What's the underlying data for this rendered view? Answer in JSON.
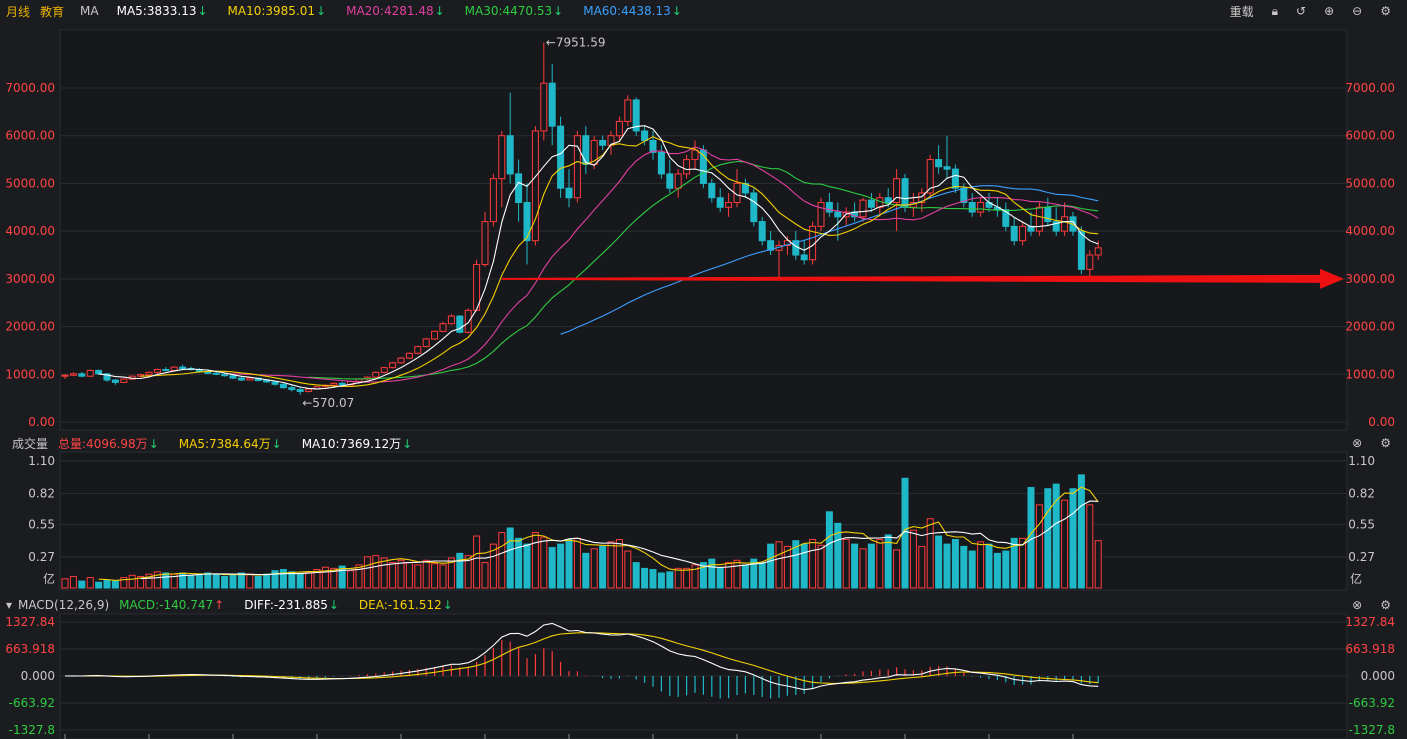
{
  "header": {
    "period": "月线",
    "name": "教育",
    "indicator": "MA",
    "ma5": "MA5:3833.13",
    "ma10": "MA10:3985.01",
    "ma20": "MA20:4281.48",
    "ma30": "MA30:4470.53",
    "ma60": "MA60:4438.13",
    "down_arrow": "↓",
    "reload": "重载"
  },
  "volume_header": {
    "title": "成交量",
    "total": "总量:4096.98万",
    "ma5": "MA5:7384.64万",
    "ma10": "MA10:7369.12万",
    "arrow": "↓"
  },
  "macd_header": {
    "title": "MACD(12,26,9)",
    "macd": "MACD:-140.747",
    "macd_arrow": "↑",
    "diff": "DIFF:-231.885",
    "dea": "DEA:-161.512",
    "arrow": "↓"
  },
  "colors": {
    "up": "#ff3b3b",
    "down": "#1fb8c8",
    "ma5": "#ffffff",
    "ma10": "#f5d000",
    "ma20": "#e040a0",
    "ma30": "#2ecc40",
    "ma60": "#3aa0ff",
    "grid": "#2a2c33",
    "axis_text": "#ff4444",
    "annotation_arrow": "#ee1111"
  },
  "chart_data": [
    {
      "type": "candlestick",
      "ylim": [
        0,
        8000
      ],
      "y_ticks": [
        "7000.00",
        "6000.00",
        "5000.00",
        "4000.00",
        "3000.00",
        "2000.00",
        "1000.00",
        "0.00"
      ],
      "annotations": {
        "high": "←7951.59",
        "low": "←570.07"
      },
      "highlight_level": 3000,
      "ohlc": [
        [
          960,
          1000,
          900,
          980
        ],
        [
          980,
          1040,
          960,
          1010
        ],
        [
          1010,
          1050,
          940,
          960
        ],
        [
          960,
          1100,
          950,
          1080
        ],
        [
          1080,
          1100,
          990,
          1010
        ],
        [
          1010,
          1020,
          840,
          880
        ],
        [
          880,
          900,
          780,
          830
        ],
        [
          830,
          920,
          820,
          900
        ],
        [
          900,
          980,
          880,
          960
        ],
        [
          960,
          1010,
          930,
          990
        ],
        [
          990,
          1060,
          970,
          1040
        ],
        [
          1040,
          1120,
          1020,
          1100
        ],
        [
          1100,
          1150,
          1060,
          1080
        ],
        [
          1080,
          1170,
          1060,
          1150
        ],
        [
          1150,
          1200,
          1100,
          1120
        ],
        [
          1120,
          1160,
          1080,
          1100
        ],
        [
          1100,
          1130,
          1030,
          1050
        ],
        [
          1050,
          1080,
          1000,
          1020
        ],
        [
          1020,
          1060,
          980,
          1000
        ],
        [
          1000,
          1030,
          950,
          970
        ],
        [
          970,
          1010,
          900,
          920
        ],
        [
          920,
          960,
          860,
          880
        ],
        [
          880,
          940,
          870,
          920
        ],
        [
          920,
          930,
          850,
          870
        ],
        [
          870,
          900,
          820,
          840
        ],
        [
          840,
          860,
          760,
          790
        ],
        [
          790,
          830,
          700,
          720
        ],
        [
          720,
          760,
          640,
          680
        ],
        [
          680,
          720,
          570,
          640
        ],
        [
          640,
          700,
          620,
          690
        ],
        [
          690,
          760,
          680,
          740
        ],
        [
          740,
          790,
          720,
          770
        ],
        [
          770,
          830,
          750,
          810
        ],
        [
          810,
          840,
          760,
          780
        ],
        [
          780,
          860,
          770,
          850
        ],
        [
          850,
          920,
          830,
          900
        ],
        [
          900,
          960,
          880,
          940
        ],
        [
          940,
          1060,
          920,
          1040
        ],
        [
          1040,
          1160,
          1020,
          1140
        ],
        [
          1140,
          1260,
          1120,
          1240
        ],
        [
          1240,
          1360,
          1220,
          1340
        ],
        [
          1340,
          1460,
          1320,
          1440
        ],
        [
          1440,
          1600,
          1420,
          1580
        ],
        [
          1580,
          1760,
          1560,
          1740
        ],
        [
          1740,
          1920,
          1720,
          1900
        ],
        [
          1900,
          2100,
          1880,
          2060
        ],
        [
          2060,
          2260,
          2040,
          2220
        ],
        [
          2220,
          2240,
          1860,
          1880
        ],
        [
          1880,
          2380,
          1860,
          2340
        ],
        [
          2340,
          3400,
          2320,
          3300
        ],
        [
          3300,
          4400,
          3250,
          4200
        ],
        [
          4200,
          5200,
          4100,
          5100
        ],
        [
          5100,
          6100,
          4500,
          6000
        ],
        [
          6000,
          6900,
          5000,
          5200
        ],
        [
          5200,
          5500,
          4200,
          4600
        ],
        [
          4600,
          5000,
          3300,
          3800
        ],
        [
          3800,
          6200,
          3700,
          6100
        ],
        [
          6100,
          7951,
          5900,
          7100
        ],
        [
          7100,
          7500,
          5800,
          6200
        ],
        [
          6200,
          6400,
          4700,
          4900
        ],
        [
          4900,
          5300,
          4500,
          4700
        ],
        [
          4700,
          6100,
          4600,
          6000
        ],
        [
          6000,
          6200,
          5200,
          5400
        ],
        [
          5400,
          6000,
          5300,
          5900
        ],
        [
          5900,
          6000,
          5700,
          5800
        ],
        [
          5800,
          6100,
          5600,
          6000
        ],
        [
          6000,
          6400,
          5900,
          6300
        ],
        [
          6300,
          6850,
          6200,
          6750
        ],
        [
          6750,
          6800,
          6000,
          6100
        ],
        [
          6100,
          6200,
          5800,
          5900
        ],
        [
          5900,
          6100,
          5500,
          5650
        ],
        [
          5650,
          5800,
          5100,
          5200
        ],
        [
          5200,
          5500,
          4800,
          4900
        ],
        [
          4900,
          5300,
          4700,
          5200
        ],
        [
          5200,
          5600,
          5100,
          5500
        ],
        [
          5500,
          5900,
          5300,
          5700
        ],
        [
          5700,
          5800,
          4900,
          5000
        ],
        [
          5000,
          5100,
          4600,
          4700
        ],
        [
          4700,
          4900,
          4400,
          4500
        ],
        [
          4500,
          4800,
          4300,
          4600
        ],
        [
          4600,
          5300,
          4500,
          5000
        ],
        [
          5000,
          5100,
          4700,
          4800
        ],
        [
          4800,
          4900,
          4100,
          4200
        ],
        [
          4200,
          4300,
          3700,
          3800
        ],
        [
          3800,
          4000,
          3500,
          3600
        ],
        [
          3600,
          3800,
          3000,
          3700
        ],
        [
          3700,
          3900,
          3500,
          3800
        ],
        [
          3800,
          4000,
          3400,
          3500
        ],
        [
          3500,
          3800,
          3300,
          3400
        ],
        [
          3400,
          4200,
          3300,
          4100
        ],
        [
          4100,
          4700,
          4000,
          4600
        ],
        [
          4600,
          4800,
          4300,
          4400
        ],
        [
          4400,
          4600,
          3800,
          4300
        ],
        [
          4300,
          4500,
          4100,
          4400
        ],
        [
          4400,
          4600,
          4200,
          4300
        ],
        [
          4300,
          4700,
          4200,
          4650
        ],
        [
          4650,
          4800,
          4400,
          4500
        ],
        [
          4500,
          4800,
          4300,
          4700
        ],
        [
          4700,
          4900,
          4500,
          4600
        ],
        [
          4600,
          5300,
          4000,
          5100
        ],
        [
          5100,
          5200,
          4400,
          4500
        ],
        [
          4500,
          4800,
          4300,
          4600
        ],
        [
          4600,
          4900,
          4400,
          4800
        ],
        [
          4800,
          5600,
          4700,
          5500
        ],
        [
          5500,
          5800,
          5200,
          5350
        ],
        [
          5350,
          6000,
          5100,
          5300
        ],
        [
          5300,
          5400,
          4800,
          4900
        ],
        [
          4900,
          5000,
          4500,
          4600
        ],
        [
          4600,
          4800,
          4300,
          4400
        ],
        [
          4400,
          4700,
          4300,
          4600
        ],
        [
          4600,
          4800,
          4400,
          4500
        ],
        [
          4500,
          4700,
          4300,
          4450
        ],
        [
          4450,
          4600,
          4000,
          4100
        ],
        [
          4100,
          4300,
          3700,
          3800
        ],
        [
          3800,
          4200,
          3700,
          4100
        ],
        [
          4100,
          4400,
          3900,
          4000
        ],
        [
          4000,
          4600,
          3900,
          4500
        ],
        [
          4500,
          4700,
          4100,
          4200
        ],
        [
          4200,
          4500,
          3900,
          4000
        ],
        [
          4000,
          4600,
          3900,
          4300
        ],
        [
          4300,
          4400,
          3900,
          4000
        ],
        [
          4000,
          4100,
          3100,
          3200
        ],
        [
          3200,
          3600,
          3050,
          3500
        ],
        [
          3500,
          3800,
          3400,
          3650
        ]
      ]
    },
    {
      "type": "bar",
      "title": "成交量",
      "unit": "亿",
      "ylim": [
        0,
        1.1
      ],
      "y_ticks": [
        "1.10",
        "0.82",
        "0.55",
        "0.27"
      ],
      "values": [
        0.08,
        0.1,
        0.06,
        0.09,
        0.05,
        0.07,
        0.06,
        0.09,
        0.11,
        0.1,
        0.12,
        0.14,
        0.13,
        0.12,
        0.13,
        0.11,
        0.12,
        0.13,
        0.12,
        0.1,
        0.11,
        0.13,
        0.12,
        0.1,
        0.12,
        0.15,
        0.16,
        0.14,
        0.12,
        0.14,
        0.16,
        0.18,
        0.17,
        0.19,
        0.15,
        0.2,
        0.27,
        0.28,
        0.26,
        0.22,
        0.24,
        0.22,
        0.2,
        0.24,
        0.21,
        0.2,
        0.26,
        0.3,
        0.28,
        0.45,
        0.22,
        0.38,
        0.48,
        0.52,
        0.43,
        0.38,
        0.48,
        0.44,
        0.35,
        0.38,
        0.42,
        0.43,
        0.3,
        0.34,
        0.36,
        0.4,
        0.42,
        0.32,
        0.22,
        0.17,
        0.16,
        0.13,
        0.14,
        0.17,
        0.17,
        0.2,
        0.22,
        0.25,
        0.17,
        0.22,
        0.24,
        0.2,
        0.25,
        0.22,
        0.38,
        0.4,
        0.36,
        0.41,
        0.38,
        0.42,
        0.37,
        0.66,
        0.56,
        0.42,
        0.38,
        0.34,
        0.38,
        0.42,
        0.46,
        0.33,
        0.95,
        0.5,
        0.36,
        0.6,
        0.45,
        0.38,
        0.42,
        0.36,
        0.32,
        0.4,
        0.38,
        0.3,
        0.32,
        0.43,
        0.43,
        0.87,
        0.72,
        0.86,
        0.9,
        0.76,
        0.86,
        0.98,
        0.72,
        0.41
      ]
    },
    {
      "type": "bar+line",
      "title": "MACD(12,26,9)",
      "ylim": [
        -1327.8,
        1327.84
      ],
      "y_ticks": [
        "1327.84",
        "663.918",
        "0.000",
        "-663.92",
        "-1327.8"
      ]
    }
  ]
}
